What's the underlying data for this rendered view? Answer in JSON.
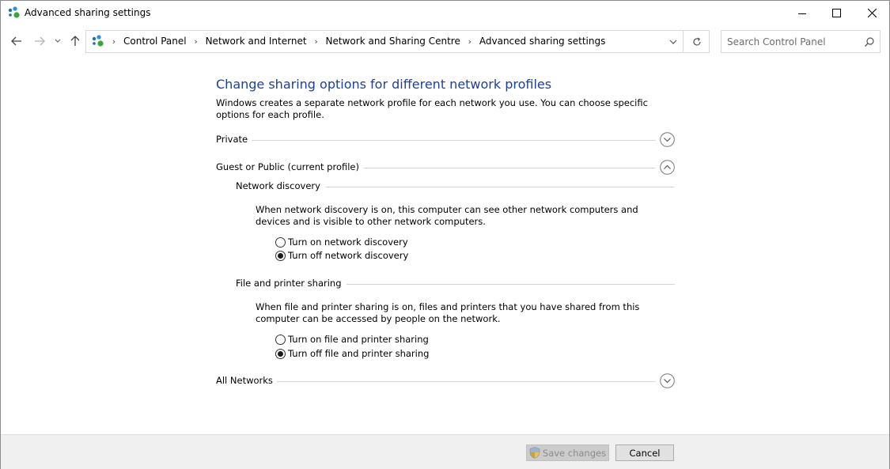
{
  "window": {
    "title": "Advanced sharing settings"
  },
  "nav": {
    "breadcrumbs": [
      "Control Panel",
      "Network and Internet",
      "Network and Sharing Centre",
      "Advanced sharing settings"
    ],
    "search_placeholder": "Search Control Panel"
  },
  "main": {
    "heading": "Change sharing options for different network profiles",
    "intro": "Windows creates a separate network profile for each network you use. You can choose specific options for each profile.",
    "sections": {
      "private": {
        "label": "Private",
        "expanded": false
      },
      "guest_public": {
        "label": "Guest or Public (current profile)",
        "expanded": true
      },
      "all_networks": {
        "label": "All Networks",
        "expanded": false
      }
    },
    "network_discovery": {
      "label": "Network discovery",
      "description": "When network discovery is on, this computer can see other network computers and devices and is visible to other network computers.",
      "options": [
        "Turn on network discovery",
        "Turn off network discovery"
      ],
      "selected": "Turn off network discovery"
    },
    "file_printer_sharing": {
      "label": "File and printer sharing",
      "description": "When file and printer sharing is on, files and printers that you have shared from this computer can be accessed by people on the network.",
      "options": [
        "Turn on file and printer sharing",
        "Turn off file and printer sharing"
      ],
      "selected": "Turn off file and printer sharing"
    }
  },
  "footer": {
    "save_label": "Save changes",
    "save_enabled": false,
    "cancel_label": "Cancel"
  },
  "colors": {
    "heading": "#1e3f9c",
    "footer_bg": "#f0f0f0"
  }
}
